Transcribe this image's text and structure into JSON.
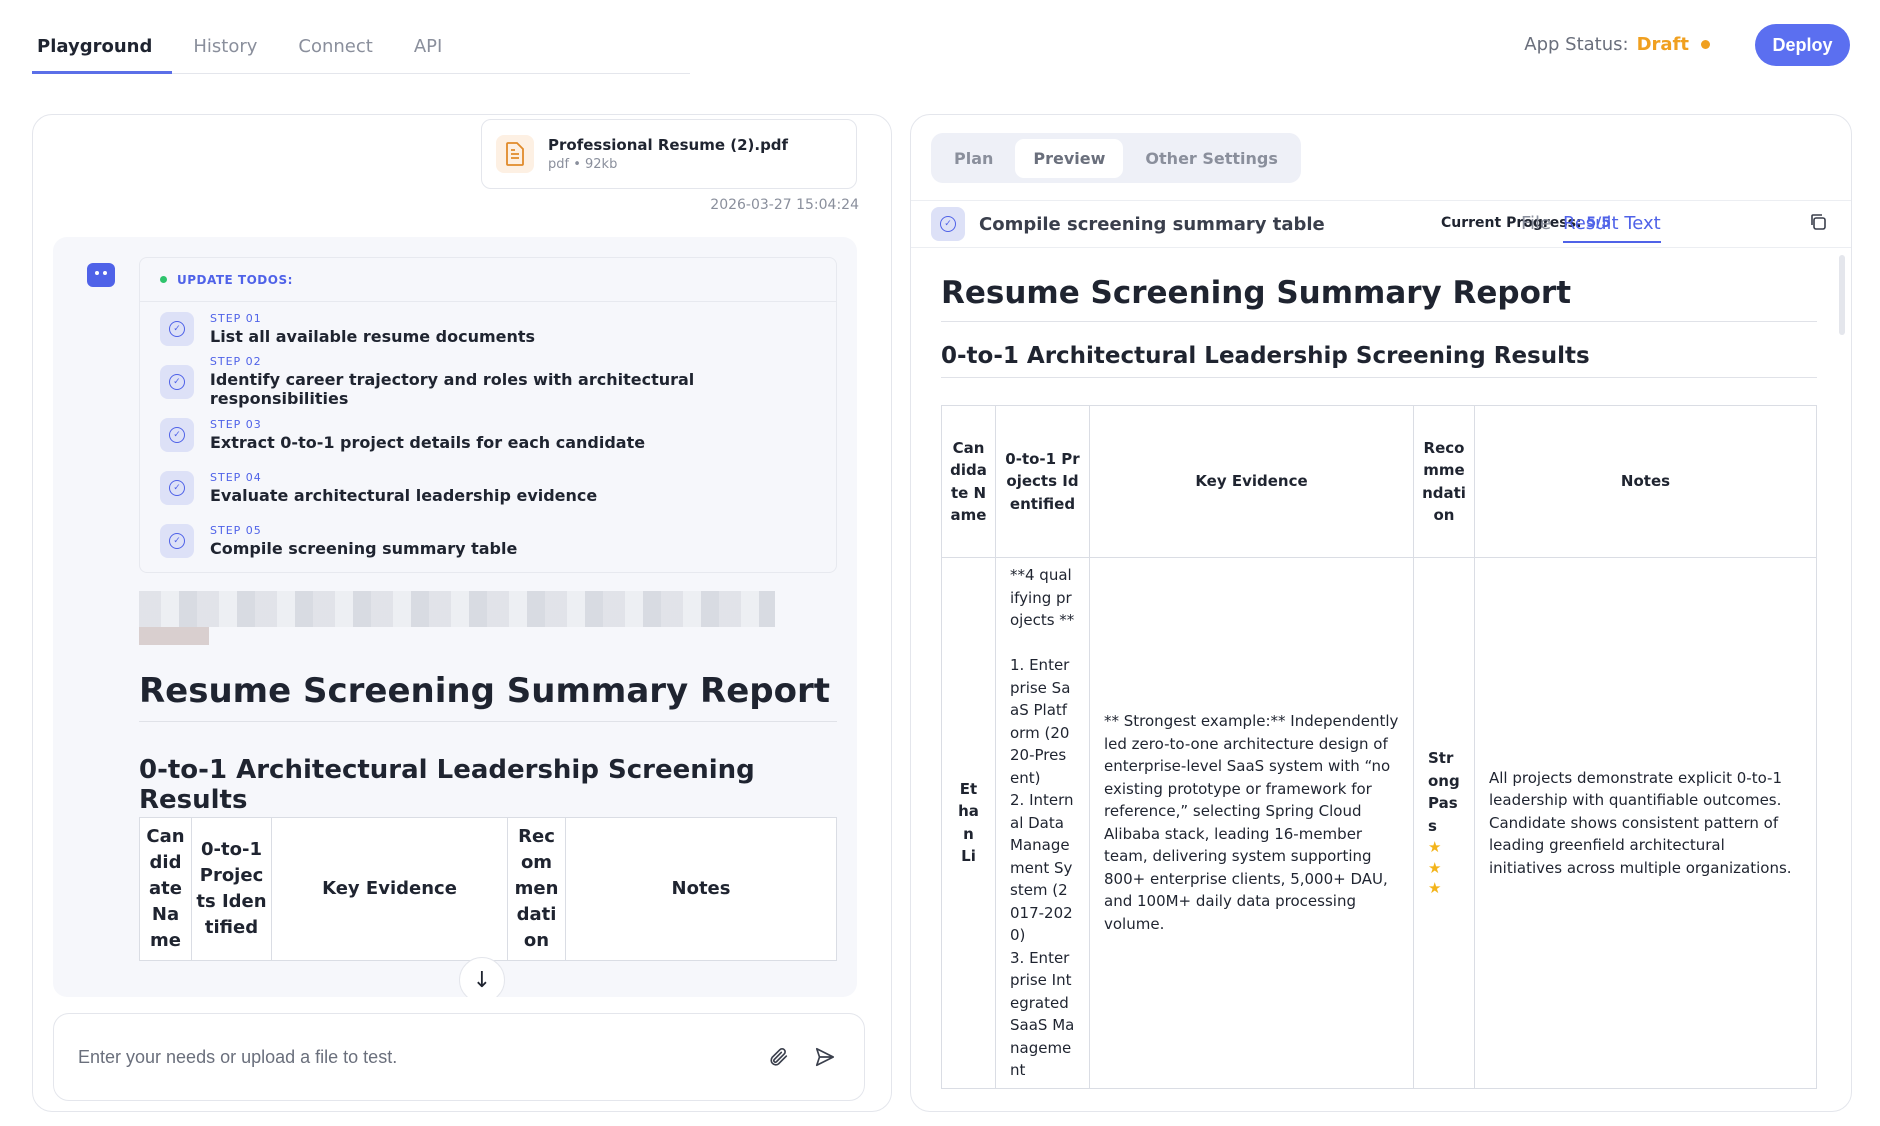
{
  "nav": {
    "tabs": [
      {
        "label": "Playground",
        "active": true
      },
      {
        "label": "History",
        "active": false
      },
      {
        "label": "Connect",
        "active": false
      },
      {
        "label": "API",
        "active": false
      }
    ]
  },
  "status": {
    "label": "App Status:",
    "value": "Draft",
    "color": "#f0a020"
  },
  "deploy_label": "Deploy",
  "accent_color": "#5b6ff0",
  "file": {
    "name": "Professional Resume (2).pdf",
    "meta": "pdf • 92kb",
    "icon": "document-icon"
  },
  "timestamp": "2026-03-27 15:04:24",
  "todos": {
    "header": "UPDATE TODOS:",
    "steps": [
      {
        "label": "STEP 01",
        "text": "List all available resume documents"
      },
      {
        "label": "STEP 02",
        "text": "Identify career trajectory and roles with architectural responsibilities"
      },
      {
        "label": "STEP 03",
        "text": "Extract 0-to-1 project details for each candidate"
      },
      {
        "label": "STEP 04",
        "text": "Evaluate architectural leadership evidence"
      },
      {
        "label": "STEP 05",
        "text": "Compile screening summary table"
      }
    ]
  },
  "report": {
    "title": "Resume Screening Summary Report",
    "subtitle": "0-to-1 Architectural Leadership Screening Results",
    "columns": [
      "Candidate Name",
      "0-to-1 Projects Identified",
      "Key Evidence",
      "Recommendation",
      "Notes"
    ],
    "rows": [
      {
        "name": "Ethan Li",
        "projects": "**4 qualifying projects **\n\n1. Enterprise SaaS Platform (2020-Present)\n2. Internal Data Management System (2017-2020)\n3. Enterprise Integrated SaaS Management",
        "evidence": "** Strongest example:** Independently led zero-to-one architecture design of enterprise-level SaaS system with “no existing prototype or framework for reference,” selecting Spring Cloud Alibaba stack, leading 16-member team, delivering system supporting 800+ enterprise clients, 5,000+ DAU, and 100M+ daily data processing volume.",
        "recommendation": "Strong Pass",
        "stars": 3,
        "notes": "All projects demonstrate explicit 0-to-1 leadership with quantifiable outcomes. Candidate shows consistent pattern of leading greenfield architectural initiatives across multiple organizations."
      }
    ]
  },
  "input": {
    "placeholder": "Enter your needs or upload a file to test."
  },
  "right": {
    "segments": [
      {
        "label": "Plan",
        "active": false
      },
      {
        "label": "Preview",
        "active": true
      },
      {
        "label": "Other Settings",
        "active": false
      }
    ],
    "task_title": "Compile screening summary table",
    "progress_label": "Current Progress:",
    "progress_value": "5/5",
    "progress_fraction": 1.0,
    "tabs": [
      {
        "label": "File",
        "active": false
      },
      {
        "label": "Result Text",
        "active": true
      }
    ]
  }
}
